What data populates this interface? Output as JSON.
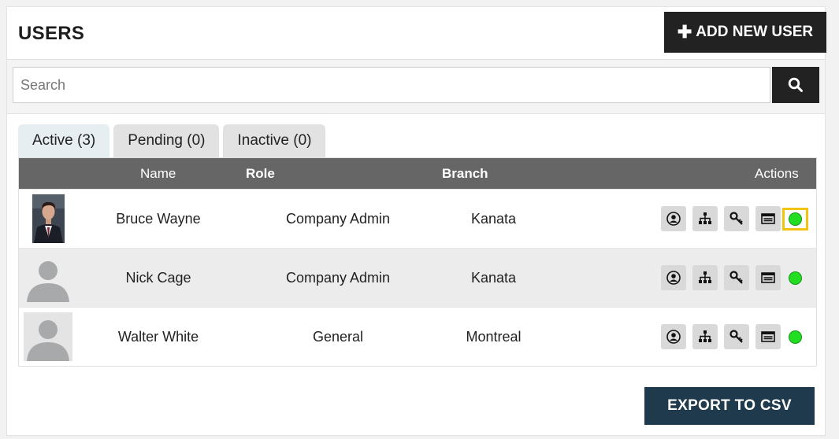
{
  "header": {
    "title": "USERS",
    "add_button_label": "ADD NEW USER"
  },
  "search": {
    "placeholder": "Search",
    "value": ""
  },
  "tabs": [
    {
      "label": "Active (3)",
      "active": true
    },
    {
      "label": "Pending (0)",
      "active": false
    },
    {
      "label": "Inactive (0)",
      "active": false
    }
  ],
  "table": {
    "columns": [
      "Name",
      "Role",
      "Branch",
      "Actions"
    ],
    "rows": [
      {
        "name": "Bruce Wayne",
        "role": "Company Admin",
        "branch": "Kanata",
        "avatar": "photo",
        "status": "active"
      },
      {
        "name": "Nick Cage",
        "role": "Company Admin",
        "branch": "Kanata",
        "avatar": "placeholder",
        "status": "active"
      },
      {
        "name": "Walter White",
        "role": "General",
        "branch": "Montreal",
        "avatar": "placeholder",
        "status": "active"
      }
    ],
    "action_icons": [
      "user-profile-icon",
      "org-chart-icon",
      "key-icon",
      "id-card-icon"
    ]
  },
  "footer": {
    "export_label": "EXPORT TO CSV"
  },
  "colors": {
    "header_bar": "#666666",
    "primary_button": "#222222",
    "export_button": "#1e3a4c",
    "status_active": "#22dd22",
    "highlight": "#f2c40f"
  }
}
